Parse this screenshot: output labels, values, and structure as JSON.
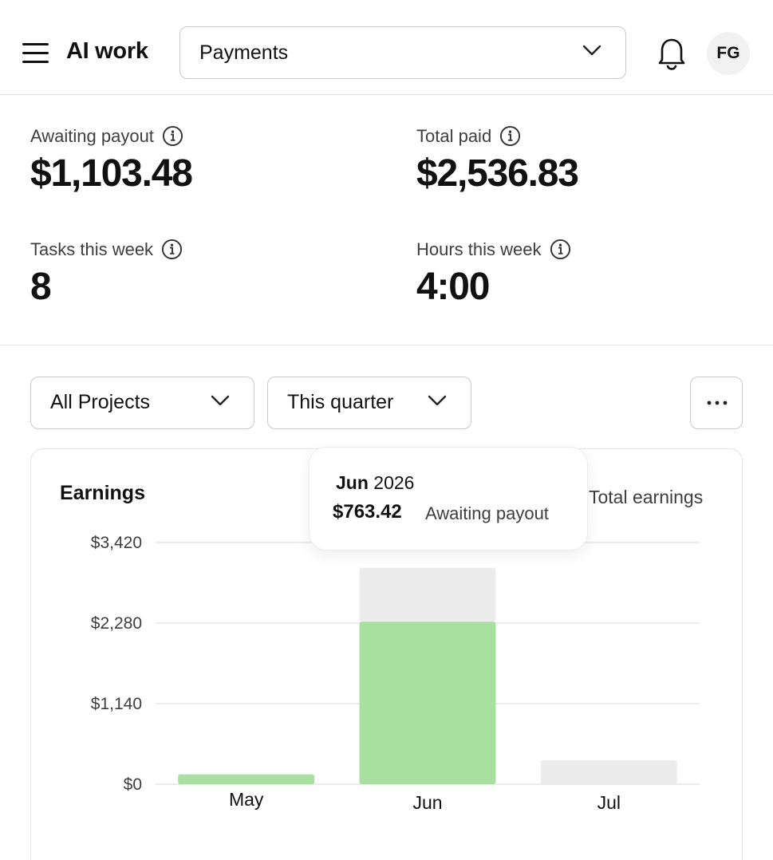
{
  "header": {
    "app_title": "AI work",
    "page_select_value": "Payments",
    "avatar_initials": "FG"
  },
  "stats": {
    "awaiting_payout_label": "Awaiting payout",
    "awaiting_payout_value": "$1,103.48",
    "total_paid_label": "Total paid",
    "total_paid_value": "$2,536.83",
    "tasks_label": "Tasks this week",
    "tasks_value": "8",
    "hours_label": "Hours this week",
    "hours_value": "4:00"
  },
  "filters": {
    "project_value": "All Projects",
    "period_value": "This quarter"
  },
  "card": {
    "title": "Earnings",
    "legend_label": "Total earnings"
  },
  "tooltip": {
    "month": "Jun",
    "year": "2026",
    "amount": "$763.42",
    "status": "Awaiting payout"
  },
  "colors": {
    "paid": "#a8e0a0",
    "awaiting": "#ececec",
    "grid": "#d9d9d9"
  },
  "icons": [
    "menu-icon",
    "chevron-down-icon",
    "bell-icon",
    "info-icon",
    "more-dots-icon"
  ],
  "chart_data": {
    "type": "bar",
    "stacked": true,
    "categories": [
      "May",
      "Jun",
      "Jul"
    ],
    "series": [
      {
        "values": [
          140,
          2300,
          0
        ]
      },
      {
        "values": [
          0,
          763.42,
          340
        ]
      }
    ],
    "y_ticks": [
      "$0",
      "$1,140",
      "$2,280",
      "$3,420"
    ],
    "y_tick_values": [
      0,
      1140,
      2280,
      3420
    ],
    "ylim": [
      0,
      3420
    ],
    "grid": true
  }
}
